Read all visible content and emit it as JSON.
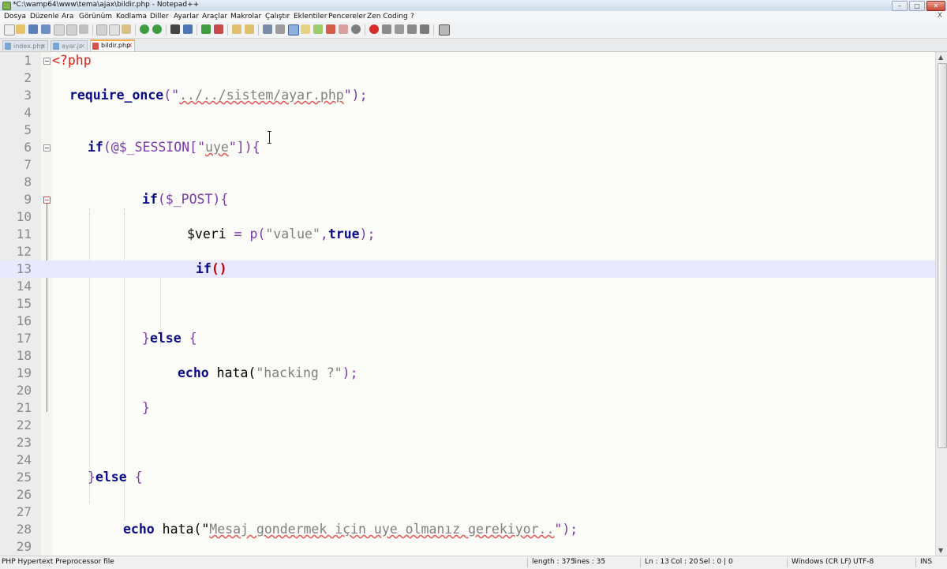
{
  "window": {
    "title": "*C:\\wamp64\\www\\tema\\ajax\\bildir.php - Notepad++",
    "buttons": [
      "–",
      "□",
      "✕"
    ]
  },
  "menu": [
    "Dosya",
    "Düzenle",
    "Ara",
    "Görünüm",
    "Kodlama",
    "Diller",
    "Ayarlar",
    "Araçlar",
    "Makrolar",
    "Çalıştır",
    "Eklentiler",
    "Pencereler",
    "Zen Coding",
    "?"
  ],
  "menu_close": "X",
  "tabs": [
    {
      "label": "index.php",
      "active": false
    },
    {
      "label": "ayar.js",
      "active": false
    },
    {
      "label": "bildir.php",
      "active": true
    }
  ],
  "editor": {
    "current_line": 13,
    "lines": [
      {
        "n": "1"
      },
      {
        "n": "2"
      },
      {
        "n": "3"
      },
      {
        "n": "4"
      },
      {
        "n": "5"
      },
      {
        "n": "6"
      },
      {
        "n": "7"
      },
      {
        "n": "8"
      },
      {
        "n": "9"
      },
      {
        "n": "10"
      },
      {
        "n": "11"
      },
      {
        "n": "12"
      },
      {
        "n": "13"
      },
      {
        "n": "14"
      },
      {
        "n": "15"
      },
      {
        "n": "16"
      },
      {
        "n": "17"
      },
      {
        "n": "18"
      },
      {
        "n": "19"
      },
      {
        "n": "20"
      },
      {
        "n": "21"
      },
      {
        "n": "22"
      },
      {
        "n": "23"
      },
      {
        "n": "24"
      },
      {
        "n": "25"
      },
      {
        "n": "26"
      },
      {
        "n": "27"
      },
      {
        "n": "28"
      },
      {
        "n": "29"
      }
    ],
    "code": {
      "l1": "<?php",
      "l3_kw": "require_once",
      "l3_open": "(\"",
      "l3_str": "../../sistem/ayar.php",
      "l3_close": "\");",
      "l6_kw": "if",
      "l6_a": "(@$_SESSION[\"",
      "l6_str": "uye",
      "l6_b": "\"]){",
      "l9_kw": "if",
      "l9_a": "($_POST){",
      "l11_var": "$veri",
      "l11_eq": " = p(",
      "l11_str": "\"value\"",
      "l11_comma": ",",
      "l11_true": "true",
      "l11_end": ");",
      "l13_kw": "if",
      "l13_br": "()",
      "l17_close": "}",
      "l17_kw": "else",
      "l17_open": " {",
      "l19_kw": "echo",
      "l19_fn": " hata(",
      "l19_str": "\"hacking ?\"",
      "l19_end": ");",
      "l21_close": "}",
      "l25_close": "}",
      "l25_kw": "else",
      "l25_open": " {",
      "l28_kw": "echo",
      "l28_fn": " hata(\"",
      "l28_str": "Mesaj gondermek için uye olmanız gerekiyor..",
      "l28_end": "\");"
    }
  },
  "status": {
    "file_type": "PHP Hypertext Preprocessor file",
    "length": "length : 375",
    "lines": "lines : 35",
    "ln": "Ln : 13",
    "col": "Col : 20",
    "sel": "Sel : 0 | 0",
    "eol": "Windows (CR LF)",
    "encoding": "UTF-8",
    "mode": "INS"
  },
  "colors": {
    "keyword": "#0b0b8a",
    "operator": "#7a3aa8",
    "string": "#808080",
    "php_tag": "#e0201b",
    "current_line_bg": "#e8e8ff"
  }
}
